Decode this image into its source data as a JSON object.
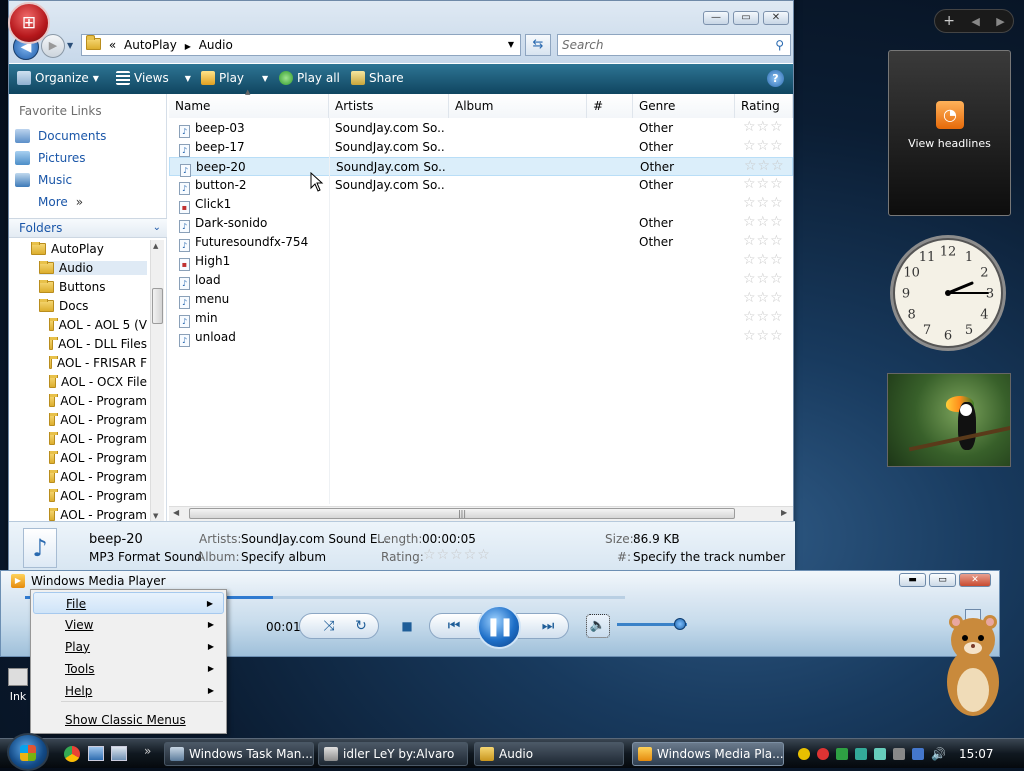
{
  "explorer": {
    "breadcrumb": {
      "sep": "«",
      "parts": [
        "AutoPlay",
        "Audio"
      ]
    },
    "search_placeholder": "Search",
    "toolbar": {
      "organize": "Organize",
      "views": "Views",
      "play": "Play",
      "play_all": "Play all",
      "share": "Share"
    },
    "favorites": {
      "title": "Favorite Links",
      "items": [
        "Documents",
        "Pictures",
        "Music"
      ],
      "more": "More"
    },
    "folders_header": "Folders",
    "tree": [
      "AutoPlay",
      "Audio",
      "Buttons",
      "Docs",
      "AOL - AOL 5 (V",
      "AOL - DLL Files",
      "AOL - FRISAR F",
      "AOL - OCX File",
      "AOL - Program",
      "AOL - Program",
      "AOL - Program",
      "AOL - Program",
      "AOL - Program",
      "AOL - Program",
      "AOL - Program"
    ],
    "columns": [
      "Name",
      "Artists",
      "Album",
      "#",
      "Genre",
      "Rating"
    ],
    "rows": [
      {
        "name": "beep-03",
        "artist": "SoundJay.com So...",
        "genre": "Other"
      },
      {
        "name": "beep-17",
        "artist": "SoundJay.com So...",
        "genre": "Other"
      },
      {
        "name": "beep-20",
        "artist": "SoundJay.com So...",
        "genre": "Other"
      },
      {
        "name": "button-2",
        "artist": "SoundJay.com So...",
        "genre": "Other"
      },
      {
        "name": "Click1",
        "artist": "",
        "genre": ""
      },
      {
        "name": "Dark-sonido",
        "artist": "",
        "genre": "Other"
      },
      {
        "name": "Futuresoundfx-754",
        "artist": "",
        "genre": "Other"
      },
      {
        "name": "High1",
        "artist": "",
        "genre": ""
      },
      {
        "name": "load",
        "artist": "",
        "genre": ""
      },
      {
        "name": "menu",
        "artist": "",
        "genre": ""
      },
      {
        "name": "min",
        "artist": "",
        "genre": ""
      },
      {
        "name": "unload",
        "artist": "",
        "genre": ""
      }
    ],
    "selected_row": 2,
    "details": {
      "name": "beep-20",
      "type": "MP3 Format Sound",
      "artists_label": "Artists:",
      "artists": "SoundJay.com Sound E...",
      "album_label": "Album:",
      "album": "Specify album",
      "length_label": "Length:",
      "length": "00:00:05",
      "rating_label": "Rating:",
      "size_label": "Size:",
      "size": "86.9 KB",
      "track_label": "#:",
      "track": "Specify the track number"
    }
  },
  "gadgets": {
    "rss_label": "View headlines",
    "clock": {
      "hour": 2,
      "minute": 15
    }
  },
  "wmp": {
    "title": "Windows Media Player",
    "time": "00:01",
    "menu": [
      {
        "label": "File",
        "sub": true
      },
      {
        "label": "View",
        "sub": true
      },
      {
        "label": "Play",
        "sub": true
      },
      {
        "label": "Tools",
        "sub": true
      },
      {
        "label": "Help",
        "sub": true
      },
      {
        "label": "Show Classic Menus",
        "sub": false
      }
    ]
  },
  "desktop": {
    "icon_label": "Ink"
  },
  "taskbar": {
    "tasks": [
      "Windows Task Man...",
      "idler LeY by:Alvaro",
      "Audio",
      "Windows Media Pla..."
    ],
    "clock": "15:07"
  }
}
